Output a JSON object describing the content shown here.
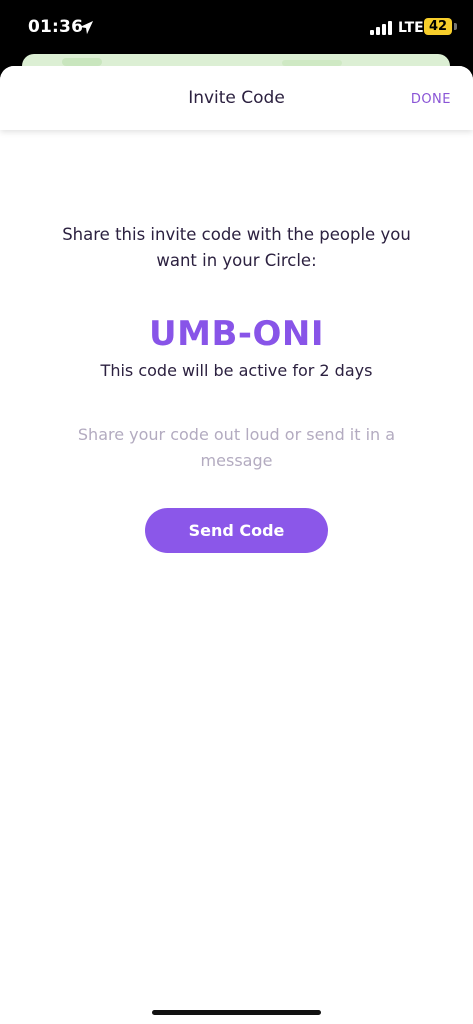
{
  "status_bar": {
    "time": "01:36",
    "network": "LTE",
    "battery": "42",
    "battery_color": "#f7ce2b"
  },
  "header": {
    "title": "Invite Code",
    "done_label": "DONE"
  },
  "main": {
    "instruction": "Share this invite code with the people you want in your Circle:",
    "invite_code": "UMB-ONI",
    "active_note": "This code will be active for 2 days",
    "hint": "Share your code out loud or send it in a message",
    "send_button_label": "Send Code"
  },
  "colors": {
    "accent": "#8b57e9",
    "text_dark": "#2c2140",
    "text_muted": "#b3abc0"
  },
  "icons": [
    "location-arrow-icon",
    "cellular-signal-icon",
    "battery-icon"
  ]
}
